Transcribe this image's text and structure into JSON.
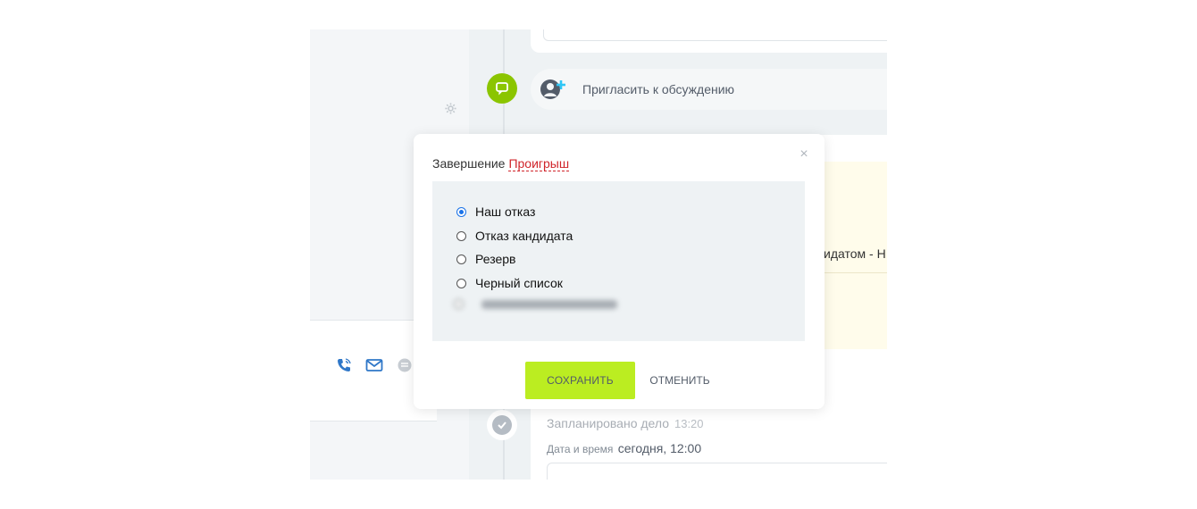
{
  "timeline": {
    "invite_label": "Пригласить к обсуждению",
    "clipped_text": "идатом - Н",
    "planned_title": "Запланировано дело",
    "planned_time": "13:20",
    "planned_date_label": "Дата и время",
    "planned_date_value": "сегодня, 12:00"
  },
  "modal": {
    "title_prefix": "Завершение",
    "result_label": "Проигрыш",
    "close_glyph": "×",
    "options": [
      {
        "label": "Наш отказ",
        "checked": true
      },
      {
        "label": "Отказ кандидата",
        "checked": false
      },
      {
        "label": "Резерв",
        "checked": false
      },
      {
        "label": "Черный список",
        "checked": false
      }
    ],
    "save_label": "СОХРАНИТЬ",
    "cancel_label": "ОТМЕНИТЬ"
  },
  "icons": {
    "chat": "chat-bubble-icon",
    "invite": "add-user-icon",
    "gear": "gear-icon",
    "phone": "phone-icon",
    "mail": "mail-icon",
    "message": "message-icon",
    "done": "check-icon"
  },
  "colors": {
    "accent_green": "#bbed21",
    "chat_dot_green": "#8bc500",
    "result_red": "#d0252b",
    "radio_blue": "#1a73e8"
  }
}
